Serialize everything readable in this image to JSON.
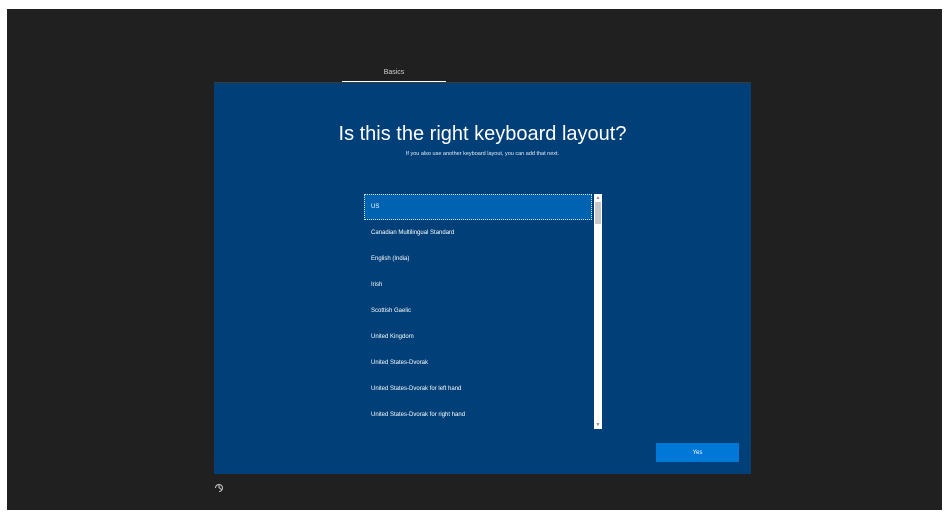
{
  "tabs": [
    {
      "label": "Basics",
      "active": true
    }
  ],
  "page": {
    "title": "Is this the right keyboard layout?",
    "subtitle": "If you also use another keyboard layout, you can add that next."
  },
  "keyboard_list": {
    "selected_index": 0,
    "items": [
      "US",
      "Canadian Multilingual Standard",
      "English (India)",
      "Irish",
      "Scottish Gaelic",
      "United Kingdom",
      "United States-Dvorak",
      "United States-Dvorak for left hand",
      "United States-Dvorak for right hand"
    ]
  },
  "actions": {
    "yes_label": "Yes"
  },
  "icons": {
    "ease_of_access": "ease-of-access-icon",
    "scroll_up": "scroll-up-arrow-icon",
    "scroll_down": "scroll-down-arrow-icon"
  },
  "colors": {
    "screen_background": "#202020",
    "panel_background": "#003f77",
    "selected_item": "#0063b1",
    "button": "#0078d7",
    "text": "#ffffff"
  }
}
